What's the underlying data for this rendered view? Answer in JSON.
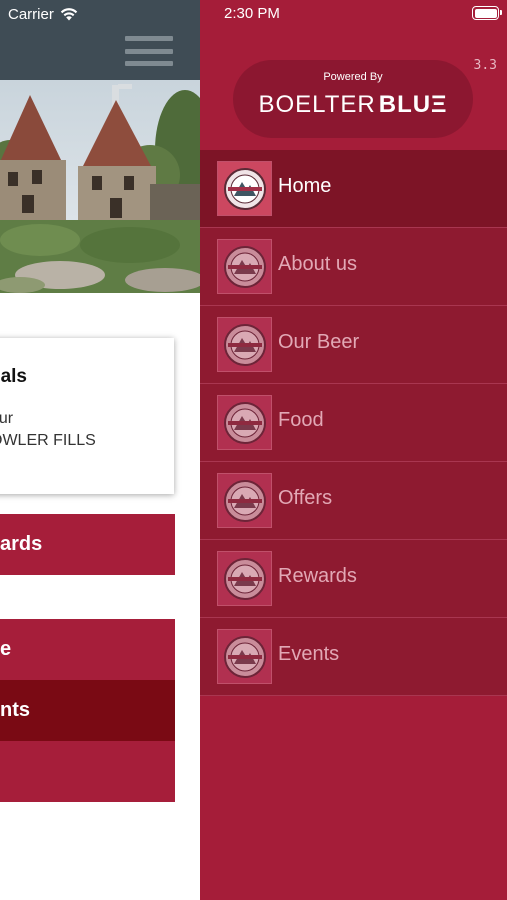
{
  "status_bar": {
    "carrier": "Carrier",
    "time": "2:30 PM"
  },
  "colors": {
    "drawer_background": "#a51d39",
    "menu_item": "#8e1a30",
    "menu_item_active": "#7d1426",
    "header": "#3f4c55",
    "button_red": "#a61e3a",
    "button_dark_red": "#7a0a14"
  },
  "drawer": {
    "version": "3.3",
    "brand": {
      "powered_by": "Powered By",
      "name_regular": "BOELTER",
      "name_bold": "BLUΞ"
    },
    "menu": [
      {
        "label": "Home",
        "icon": "brewery-logo-icon",
        "active": true
      },
      {
        "label": "About us",
        "icon": "brewery-logo-icon",
        "active": false
      },
      {
        "label": "Our Beer",
        "icon": "brewery-logo-icon",
        "active": false
      },
      {
        "label": "Food",
        "icon": "brewery-logo-icon",
        "active": false
      },
      {
        "label": "Offers",
        "icon": "brewery-logo-icon",
        "active": false
      },
      {
        "label": "Rewards",
        "icon": "brewery-logo-icon",
        "active": false
      },
      {
        "label": "Events",
        "icon": "brewery-logo-icon",
        "active": false
      }
    ]
  },
  "background_app": {
    "header_icon": "hamburger-menu-icon",
    "hero_image": "stone-kiln-towers-photo",
    "deal_card": {
      "title": "eals",
      "line1": "our",
      "line2": "OWLER FILLS"
    },
    "buttons": {
      "rewards": "ards",
      "home": "e",
      "events": "nts",
      "blank": ""
    }
  }
}
